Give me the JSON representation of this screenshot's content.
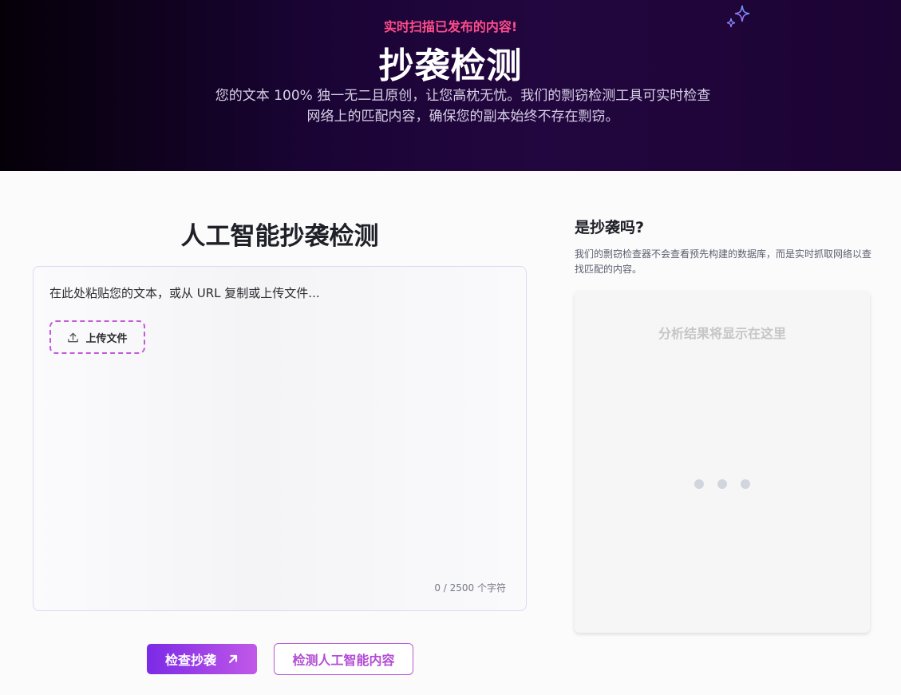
{
  "hero": {
    "tagline": "实时扫描已发布的内容!",
    "title": "抄袭检测",
    "description": "您的文本 100% 独一无二且原创，让您高枕无忧。我们的剽窃检测工具可实时检查网络上的匹配内容，确保您的副本始终不存在剽窃。"
  },
  "checker": {
    "title": "人工智能抄袭检测",
    "placeholder": "在此处粘贴您的文本，或从 URL 复制或上传文件...",
    "upload_label": "上传文件",
    "char_count": "0 / 2500 个字符"
  },
  "actions": {
    "check_label": "检查抄袭",
    "ai_detect_label": "检测人工智能内容"
  },
  "result": {
    "title": "是抄袭吗?",
    "description": "我们的剽窃检查器不会查看预先构建的数据库，而是实时抓取网络以查找匹配的内容。",
    "placeholder": "分析结果将显示在这里"
  },
  "colors": {
    "accent_purple": "#7b2ae6",
    "accent_pink": "#ff4d8a"
  }
}
